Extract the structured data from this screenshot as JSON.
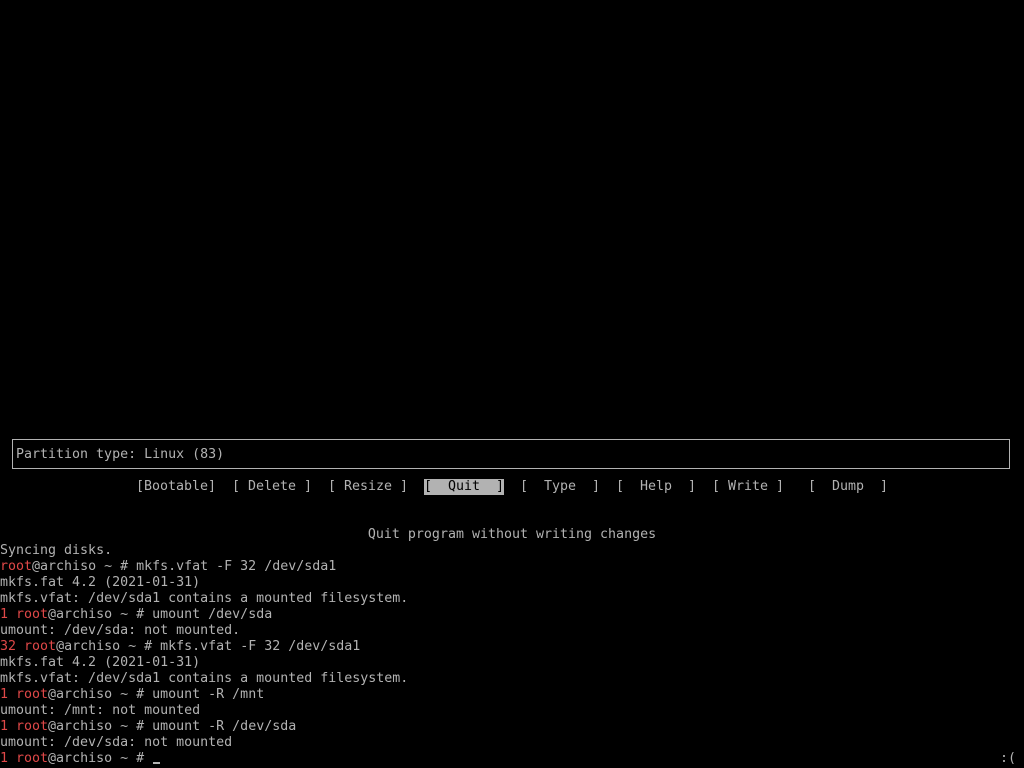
{
  "info_box": {
    "text": "Partition type: Linux (83)"
  },
  "menu": {
    "items": [
      {
        "label": "[Bootable]",
        "selected": false
      },
      {
        "label": "[ Delete ]",
        "selected": false
      },
      {
        "label": "[ Resize ]",
        "selected": false
      },
      {
        "label": "[  Quit  ]",
        "selected": true
      },
      {
        "label": "[  Type  ]",
        "selected": false
      },
      {
        "label": "[  Help  ]",
        "selected": false
      },
      {
        "label": "[ Write ]",
        "selected": false
      },
      {
        "label": "[  Dump  ]",
        "selected": false
      }
    ],
    "help_text": "Quit program without writing changes"
  },
  "prompt": {
    "user": "root",
    "host_part": "@archiso ~ # "
  },
  "terminal_lines": [
    {
      "code": "",
      "prompt": false,
      "text": "Syncing disks."
    },
    {
      "code": "",
      "prompt": true,
      "text": "mkfs.vfat -F 32 /dev/sda1"
    },
    {
      "code": "",
      "prompt": false,
      "text": "mkfs.fat 4.2 (2021-01-31)"
    },
    {
      "code": "",
      "prompt": false,
      "text": "mkfs.vfat: /dev/sda1 contains a mounted filesystem."
    },
    {
      "code": "1",
      "prompt": true,
      "text": "umount /dev/sda"
    },
    {
      "code": "",
      "prompt": false,
      "text": "umount: /dev/sda: not mounted."
    },
    {
      "code": "32",
      "prompt": true,
      "text": "mkfs.vfat -F 32 /dev/sda1"
    },
    {
      "code": "",
      "prompt": false,
      "text": "mkfs.fat 4.2 (2021-01-31)"
    },
    {
      "code": "",
      "prompt": false,
      "text": "mkfs.vfat: /dev/sda1 contains a mounted filesystem."
    },
    {
      "code": "1",
      "prompt": true,
      "text": "umount -R /mnt"
    },
    {
      "code": "",
      "prompt": false,
      "text": "umount: /mnt: not mounted"
    },
    {
      "code": "1",
      "prompt": true,
      "text": "umount -R /dev/sda"
    },
    {
      "code": "",
      "prompt": false,
      "text": "umount: /dev/sda: not mounted"
    },
    {
      "code": "1",
      "prompt": true,
      "text": ""
    }
  ],
  "status_face": ":(",
  "colors": {
    "foreground": "#b2b2b2",
    "background": "#000000",
    "accent_red": "#e04848"
  }
}
